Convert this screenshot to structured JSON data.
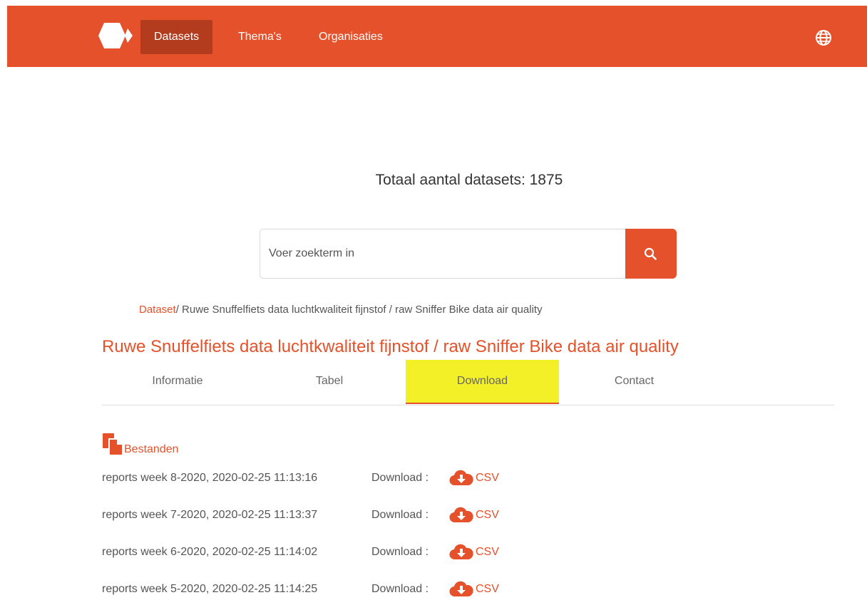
{
  "nav": {
    "items": [
      {
        "label": "Datasets",
        "active": true
      },
      {
        "label": "Thema's",
        "active": false
      },
      {
        "label": "Organisaties",
        "active": false
      }
    ],
    "language_icon": "globe-icon",
    "accent_color": "#e5512a"
  },
  "summary": {
    "total_text": "Totaal aantal datasets: 1875"
  },
  "search": {
    "placeholder": "Voer zoekterm in",
    "button_icon": "search-icon"
  },
  "breadcrumb": {
    "root": "Dataset",
    "current": "/ Ruwe Snuffelfiets data luchtkwaliteit fijnstof / raw Sniffer Bike data air quality"
  },
  "dataset": {
    "title": "Ruwe Snuffelfiets data luchtkwaliteit fijnstof / raw Sniffer Bike data air quality"
  },
  "tabs": [
    {
      "label": "Informatie",
      "active": false
    },
    {
      "label": "Tabel",
      "active": false
    },
    {
      "label": "Download",
      "active": true
    },
    {
      "label": "Contact",
      "active": false
    }
  ],
  "files": {
    "heading": "Bestanden",
    "download_label": "Download :",
    "items": [
      {
        "name": "reports week 8-2020, 2020-02-25 11:13:16",
        "format": "CSV"
      },
      {
        "name": "reports week 7-2020, 2020-02-25 11:13:37",
        "format": "CSV"
      },
      {
        "name": "reports week 6-2020, 2020-02-25 11:14:02",
        "format": "CSV"
      },
      {
        "name": "reports week 5-2020, 2020-02-25 11:14:25",
        "format": "CSV"
      }
    ]
  }
}
